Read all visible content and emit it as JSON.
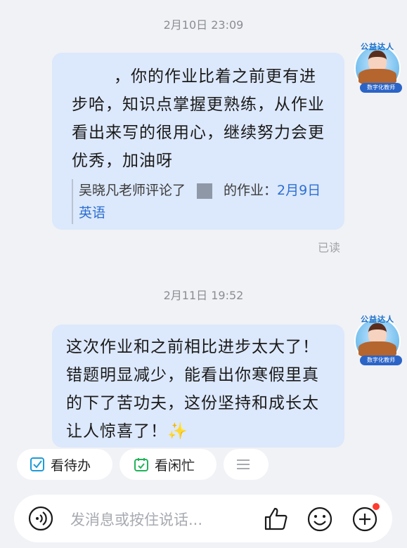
{
  "messages": [
    {
      "timestamp": "2月10日 23:09",
      "text": "，你的作业比着之前更有进步哈，知识点掌握更熟练，从作业看出来写的很用心，继续努力会更优秀，加油呀",
      "quote_prefix": "吴晓凡老师评论了",
      "quote_suffix": "的作业：",
      "quote_link": "2月9日英语",
      "read_status": "已读",
      "avatar": {
        "top_badge": "公益达人",
        "bottom_badge": "数字化教师"
      }
    },
    {
      "timestamp": "2月11日 19:52",
      "text": "这次作业和之前相比进步太大了！错题明显减少，能看出你寒假里真的下了苦功夫，这份坚持和成长太让人惊喜了！",
      "emoji": "✨",
      "avatar": {
        "top_badge": "公益达人",
        "bottom_badge": "数字化教师"
      }
    }
  ],
  "quick_actions": {
    "todo_label": "看待办",
    "busy_label": "看闲忙",
    "more_icon": "menu-icon"
  },
  "input": {
    "placeholder": "发消息或按住说话..."
  },
  "colors": {
    "bubble": "#dce8fb",
    "background": "#f1f2f6",
    "link": "#2d6fd2",
    "icon_accent": "#1e9bd7",
    "notification_dot": "#ff3b30"
  }
}
